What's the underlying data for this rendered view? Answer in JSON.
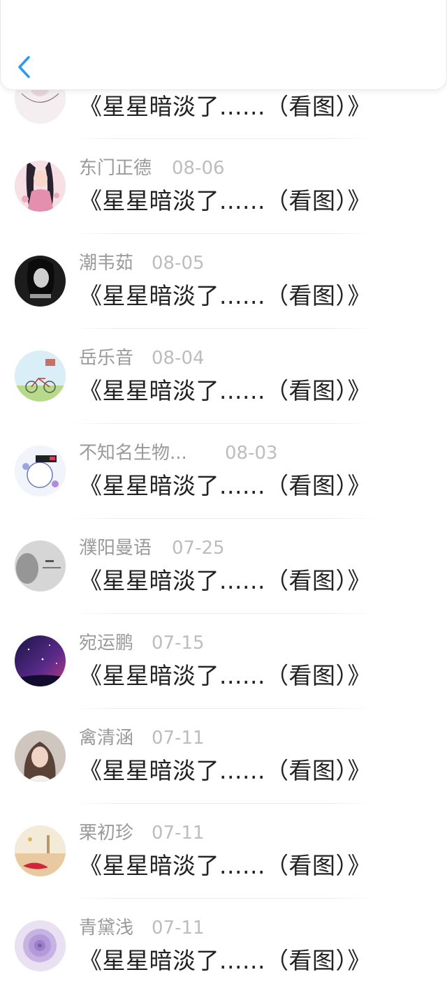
{
  "header": {
    "back_icon": "chevron-left-icon",
    "accent_color": "#2a9bf0"
  },
  "items": [
    {
      "name": "",
      "date": "",
      "title": "《星星暗淡了......（看图）》",
      "avatar": "avatar-mundane"
    },
    {
      "name": "东门正德",
      "date": "08-06",
      "title": "《星星暗淡了......（看图）》",
      "avatar": "avatar-anime-girl"
    },
    {
      "name": "潮韦茹",
      "date": "08-05",
      "title": "《星星暗淡了......（看图）》",
      "avatar": "avatar-bw-girl"
    },
    {
      "name": "岳乐音",
      "date": "08-04",
      "title": "《星星暗淡了......（看图）》",
      "avatar": "avatar-bicycle"
    },
    {
      "name": "不知名生物...",
      "date": "08-03",
      "title": "《星星暗淡了......（看图）》",
      "avatar": "avatar-cartoon"
    },
    {
      "name": "濮阳曼语",
      "date": "07-25",
      "title": "《星星暗淡了......（看图）》",
      "avatar": "avatar-grey-text"
    },
    {
      "name": "宛运鹏",
      "date": "07-15",
      "title": "《星星暗淡了......（看图）》",
      "avatar": "avatar-galaxy"
    },
    {
      "name": "禽清涵",
      "date": "07-11",
      "title": "《星星暗淡了......（看图）》",
      "avatar": "avatar-portrait"
    },
    {
      "name": "栗初珍",
      "date": "07-11",
      "title": "《星星暗淡了......（看图）》",
      "avatar": "avatar-beach"
    },
    {
      "name": "青黛浅",
      "date": "07-11",
      "title": "《星星暗淡了......（看图）》",
      "avatar": "avatar-flower"
    }
  ]
}
